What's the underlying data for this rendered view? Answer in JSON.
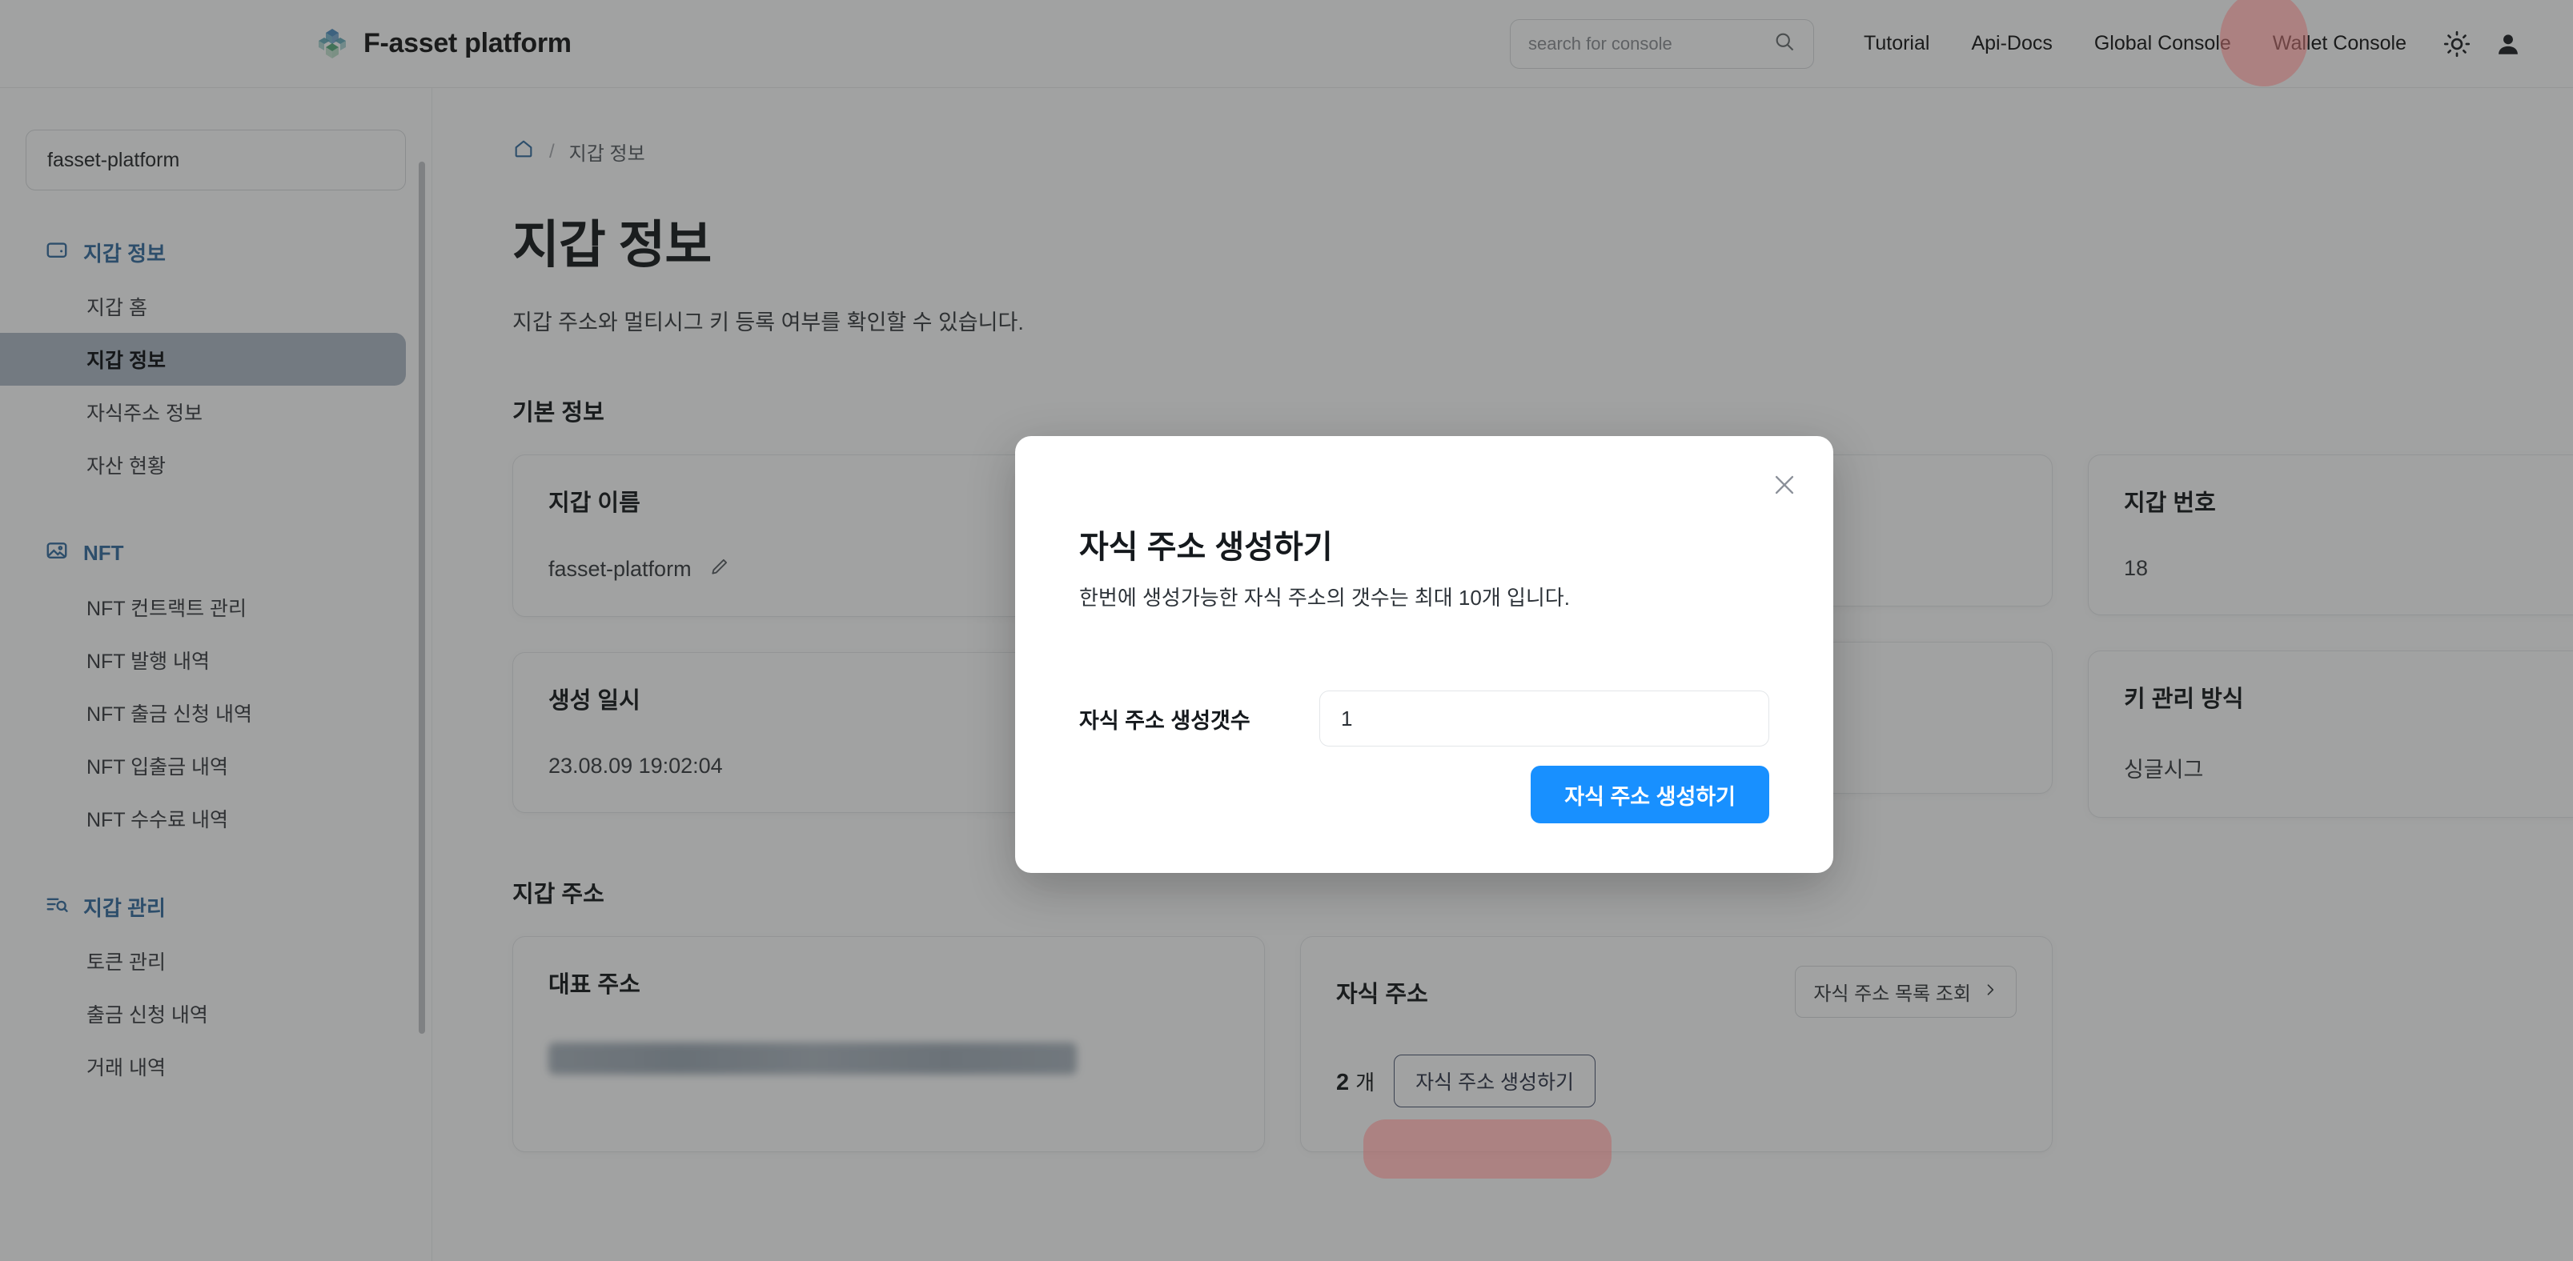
{
  "header": {
    "brand_title": "F-asset platform",
    "search": {
      "placeholder": "search for console",
      "icon": "search-icon"
    },
    "nav": [
      {
        "label": "Tutorial"
      },
      {
        "label": "Api-Docs"
      },
      {
        "label": "Global Console"
      },
      {
        "label": "Wallet Console"
      }
    ],
    "theme_icon": "sun-icon",
    "profile_icon": "user-icon"
  },
  "sidebar": {
    "wallet_select_value": "fasset-platform",
    "groups": [
      {
        "label": "지갑 정보",
        "icon": "wallet-icon",
        "items": [
          {
            "label": "지갑 홈",
            "active": false
          },
          {
            "label": "지갑 정보",
            "active": true
          },
          {
            "label": "자식주소 정보",
            "active": false
          },
          {
            "label": "자산 현황",
            "active": false
          }
        ]
      },
      {
        "label": "NFT",
        "icon": "image-icon",
        "items": [
          {
            "label": "NFT 컨트랙트 관리",
            "active": false
          },
          {
            "label": "NFT 발행 내역",
            "active": false
          },
          {
            "label": "NFT 출금 신청 내역",
            "active": false
          },
          {
            "label": "NFT 입출금 내역",
            "active": false
          },
          {
            "label": "NFT 수수료 내역",
            "active": false
          }
        ]
      },
      {
        "label": "지갑 관리",
        "icon": "list-search-icon",
        "items": [
          {
            "label": "토큰 관리",
            "active": false
          },
          {
            "label": "출금 신청 내역",
            "active": false
          },
          {
            "label": "거래 내역",
            "active": false
          }
        ]
      }
    ]
  },
  "main": {
    "breadcrumb": {
      "home_icon": "home-icon",
      "separator": "/",
      "current": "지갑 정보"
    },
    "page_title": "지갑 정보",
    "page_desc": "지갑 주소와 멀티시그 키 등록 여부를 확인할 수 있습니다.",
    "basic_section_title": "기본 정보",
    "cards": [
      {
        "label": "지갑 이름",
        "value": "fasset-platform",
        "edit_icon": "pencil-icon"
      },
      {
        "label": "생성 일시",
        "value": "23.08.09 19:02:04"
      },
      {
        "label": "지갑 번호",
        "value": "18"
      },
      {
        "label": "키 관리 방식",
        "value": "싱글시그"
      }
    ],
    "address_section_title": "지갑 주소",
    "address_cards": {
      "primary": {
        "label": "대표 주소",
        "value_redacted": true
      },
      "child": {
        "label": "자식 주소",
        "list_button": "자식 주소 목록 조회",
        "list_button_icon": "chevron-right-icon",
        "count": "2",
        "count_unit": "개",
        "create_button": "자식 주소 생성하기"
      }
    }
  },
  "modal": {
    "title": "자식 주소 생성하기",
    "description": "한번에 생성가능한 자식 주소의 갯수는 최대 10개 입니다.",
    "field_label": "자식 주소 생성갯수",
    "field_value": "1",
    "submit_label": "자식 주소 생성하기",
    "close_icon": "close-icon"
  },
  "colors": {
    "accent_blue": "#1877d2",
    "button_blue": "#1890ff",
    "active_nav_bg": "#a9bdd1",
    "highlight_pink": "#e07878"
  }
}
